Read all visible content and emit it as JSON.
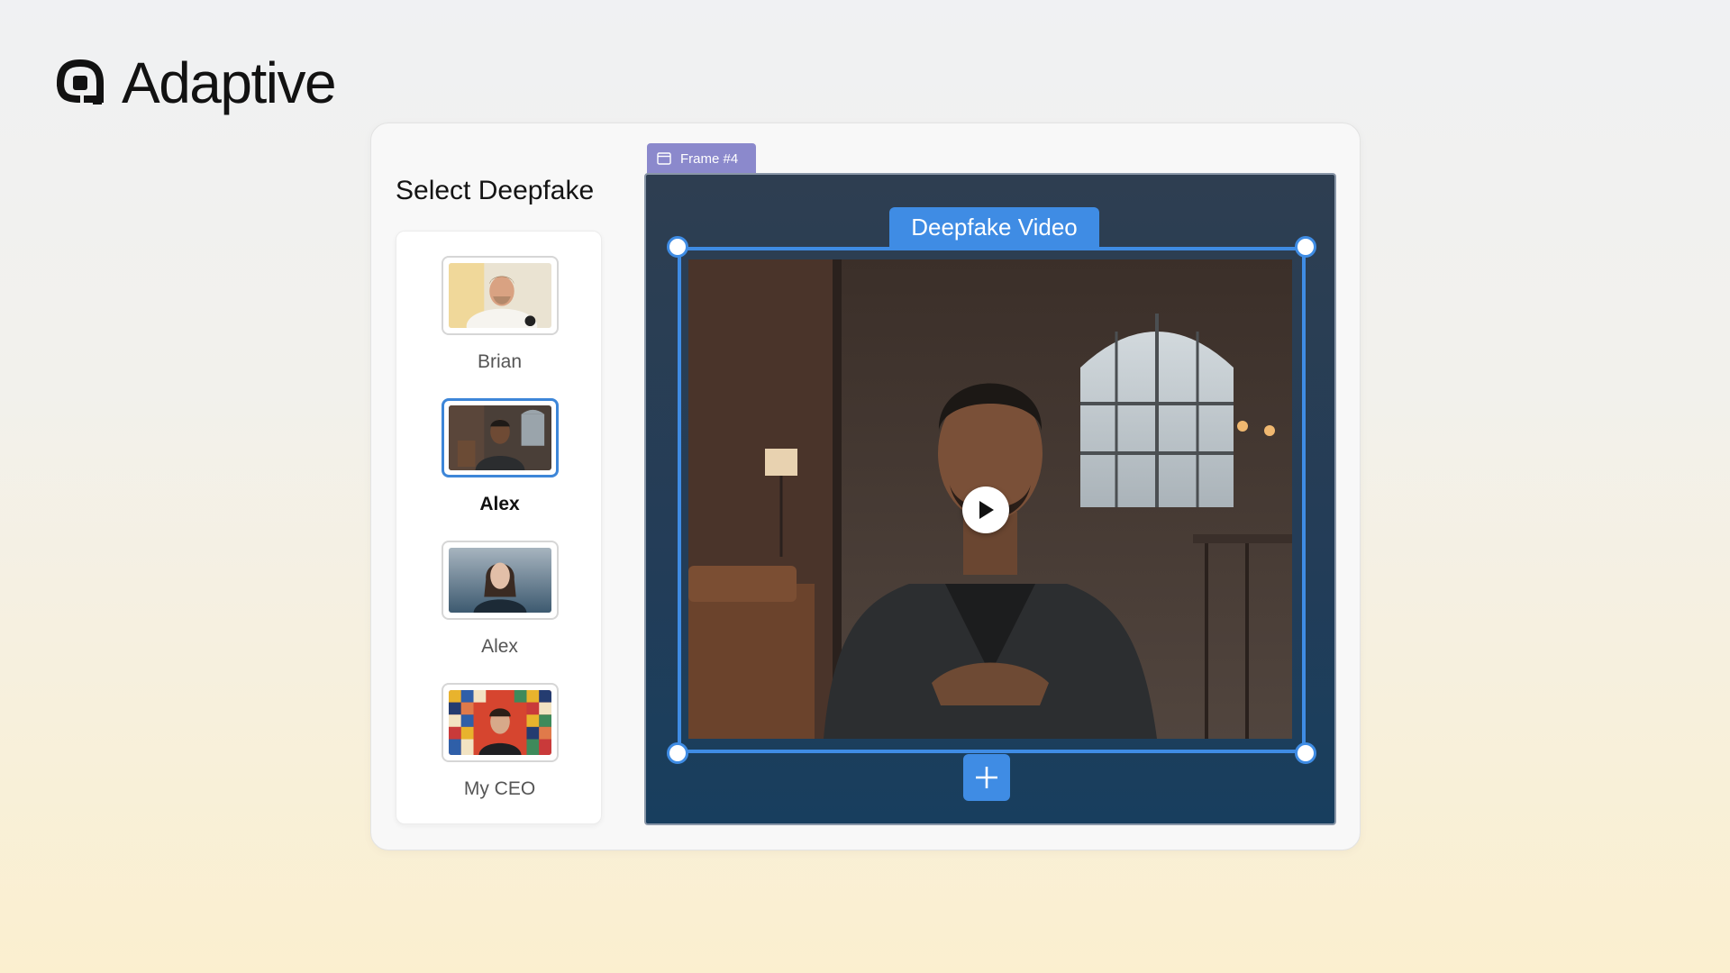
{
  "brand": {
    "name": "Adaptive",
    "logo_icon": "adaptive-logo-icon"
  },
  "panel": {
    "title": "Select Deepfake",
    "items": [
      {
        "name": "Brian",
        "selected": false
      },
      {
        "name": "Alex",
        "selected": true
      },
      {
        "name": "Alex",
        "selected": false
      },
      {
        "name": "My CEO",
        "selected": false
      }
    ]
  },
  "frame": {
    "tab_label": "Frame #4",
    "tab_icon": "frame-icon",
    "video_label": "Deepfake Video",
    "play_icon": "play-icon",
    "add_icon": "plus-icon"
  },
  "colors": {
    "accent": "#3f8ce4",
    "frame_tab": "#8b89cc",
    "frame_bg": "#233d58"
  }
}
